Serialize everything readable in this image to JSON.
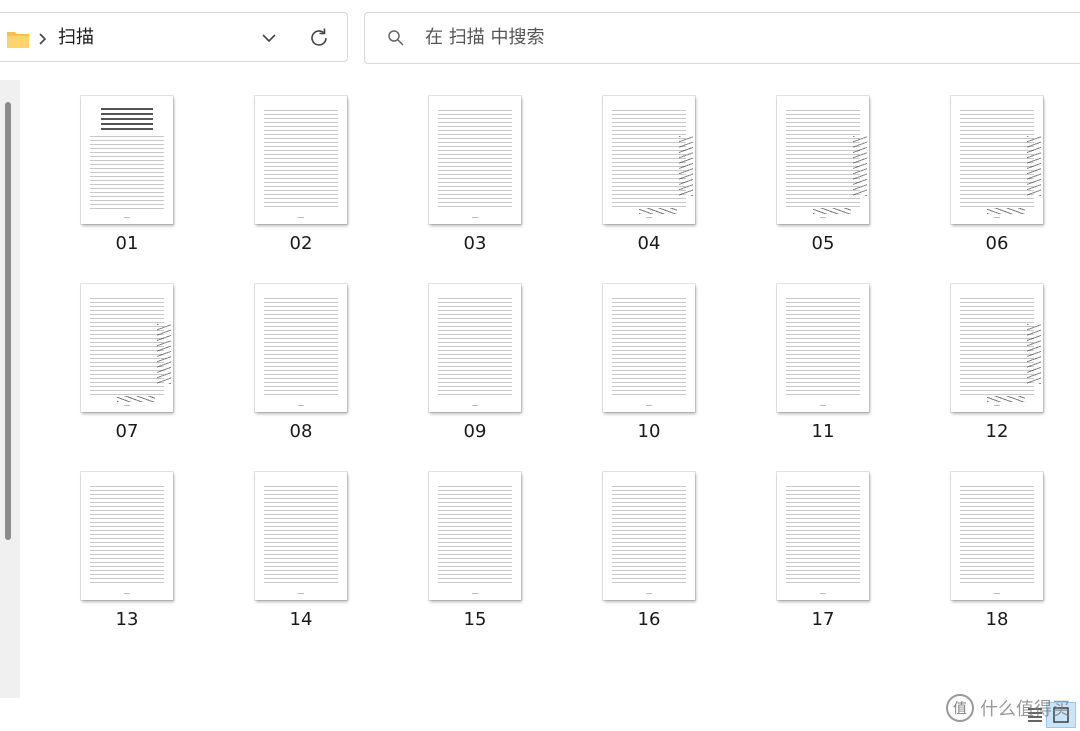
{
  "address_bar": {
    "crumb": "扫描",
    "folder_icon": "folder-icon",
    "chevron_icon": "chevron-right-icon",
    "dropdown_icon": "chevron-down-icon",
    "refresh_icon": "refresh-icon"
  },
  "search": {
    "placeholder": "在 扫描 中搜索",
    "icon": "search-icon"
  },
  "colors": {
    "folder": "#f8c14a",
    "selection": "#cce4f7",
    "border": "#d9d9d9"
  },
  "files": [
    {
      "name": "01",
      "cover": true
    },
    {
      "name": "02"
    },
    {
      "name": "03"
    },
    {
      "name": "04",
      "annotated": true
    },
    {
      "name": "05",
      "annotated": true
    },
    {
      "name": "06",
      "annotated": true
    },
    {
      "name": "07",
      "annotated": true
    },
    {
      "name": "08"
    },
    {
      "name": "09"
    },
    {
      "name": "10"
    },
    {
      "name": "11"
    },
    {
      "name": "12",
      "annotated": true
    },
    {
      "name": "13"
    },
    {
      "name": "14"
    },
    {
      "name": "15"
    },
    {
      "name": "16"
    },
    {
      "name": "17"
    },
    {
      "name": "18"
    }
  ],
  "view_buttons": {
    "details": "details-view-icon",
    "large_icons": "large-icons-view-icon"
  },
  "watermark": {
    "logo": "值",
    "text": "什么值得买"
  }
}
